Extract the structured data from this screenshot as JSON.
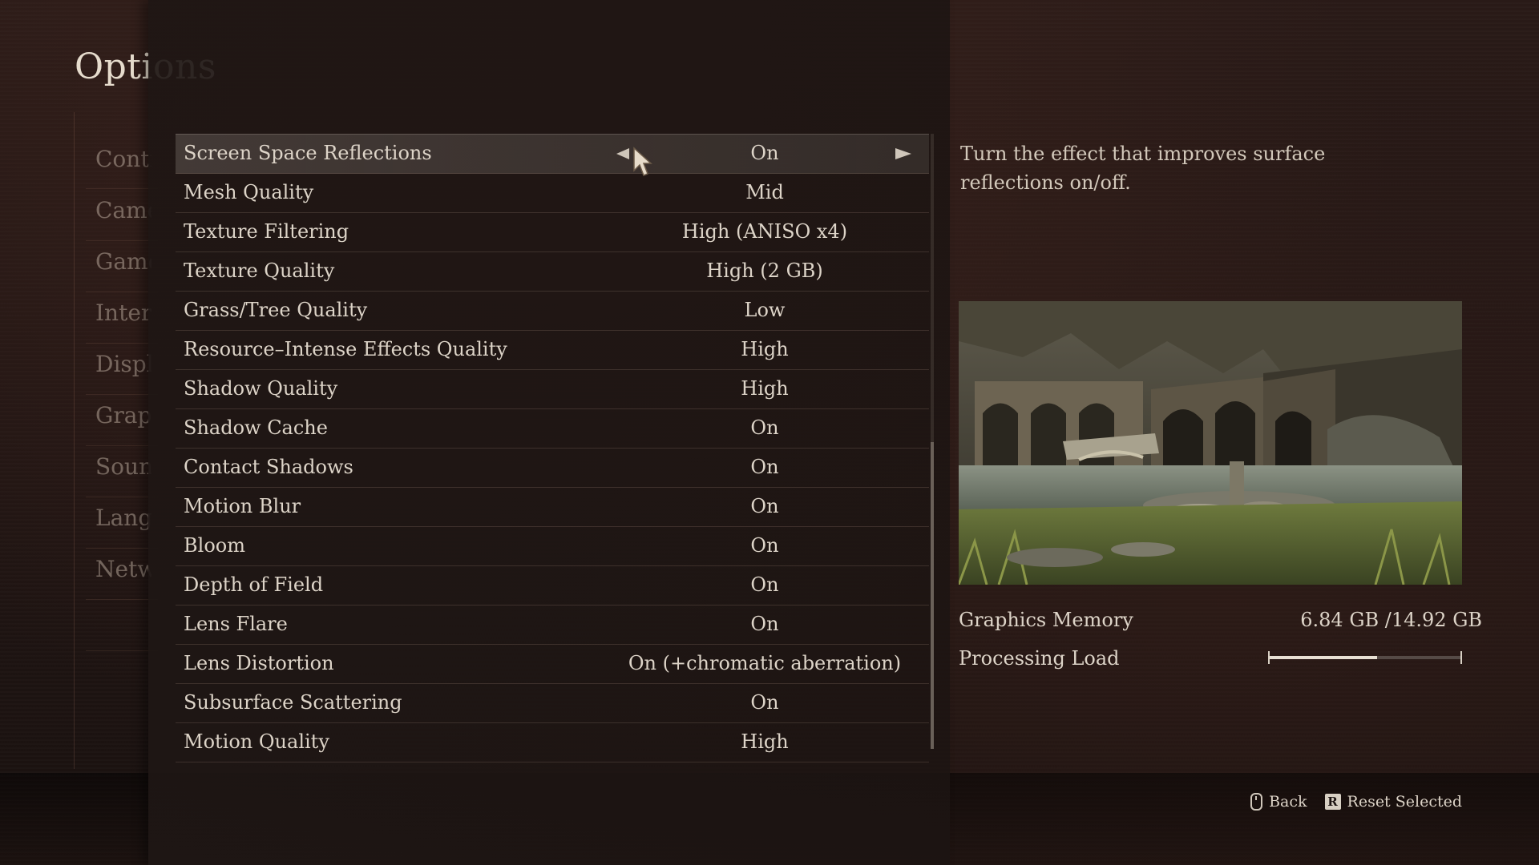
{
  "screen": {
    "title": "Options"
  },
  "categories": [
    {
      "label": "Controls"
    },
    {
      "label": "Camera"
    },
    {
      "label": "Game"
    },
    {
      "label": "Interface"
    },
    {
      "label": "Display"
    },
    {
      "label": "Graphics"
    },
    {
      "label": "Sound"
    },
    {
      "label": "Language"
    },
    {
      "label": "Network"
    }
  ],
  "settings": [
    {
      "label": "Screen Space Reflections",
      "value": "On",
      "selected": true
    },
    {
      "label": "Mesh Quality",
      "value": "Mid"
    },
    {
      "label": "Texture Filtering",
      "value": "High (ANISO x4)"
    },
    {
      "label": "Texture Quality",
      "value": "High (2 GB)"
    },
    {
      "label": "Grass/Tree Quality",
      "value": "Low"
    },
    {
      "label": "Resource–Intense Effects Quality",
      "value": "High"
    },
    {
      "label": "Shadow Quality",
      "value": "High"
    },
    {
      "label": "Shadow Cache",
      "value": "On"
    },
    {
      "label": "Contact Shadows",
      "value": "On"
    },
    {
      "label": "Motion Blur",
      "value": "On"
    },
    {
      "label": "Bloom",
      "value": "On"
    },
    {
      "label": "Depth of Field",
      "value": "On"
    },
    {
      "label": "Lens Flare",
      "value": "On"
    },
    {
      "label": "Lens Distortion",
      "value": "On (+chromatic aberration)"
    },
    {
      "label": "Subsurface Scattering",
      "value": "On"
    },
    {
      "label": "Motion Quality",
      "value": "High"
    }
  ],
  "description": "Turn the effect that improves surface reflections on/off.",
  "stats": {
    "graphics_memory_label": "Graphics Memory",
    "graphics_memory_value": "6.84 GB /14.92 GB",
    "processing_load_label": "Processing Load",
    "processing_load_fraction": 0.56
  },
  "footer": {
    "back_label": "Back",
    "reset_key": "R",
    "reset_label": "Reset Selected"
  },
  "icons": {
    "left_arrow": "left-arrow-icon",
    "right_arrow": "right-arrow-icon",
    "cursor": "pointer-cursor-icon",
    "mouse": "mouse-icon"
  },
  "colors": {
    "accent": "#e8e0d4",
    "background": "#1c1412"
  }
}
